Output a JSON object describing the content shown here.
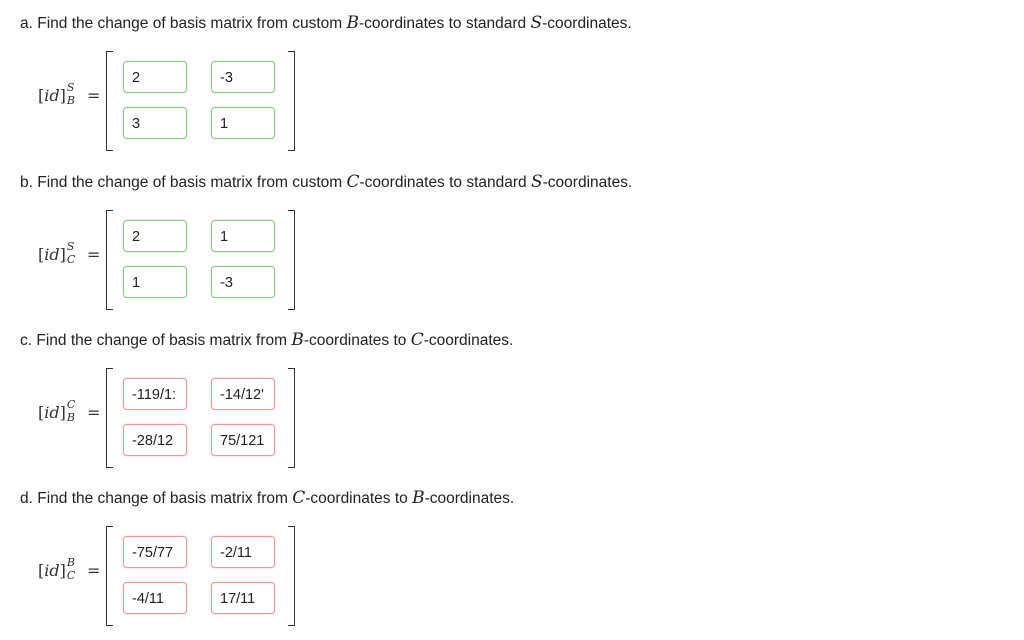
{
  "parts": [
    {
      "question": {
        "pre": "a. Find the change of basis matrix from custom ",
        "from": "B",
        "mid": "-coordinates to standard ",
        "to": "S",
        "post": "-coordinates."
      },
      "label": {
        "sup": "S",
        "sub": "B"
      },
      "cells": [
        {
          "value": "2",
          "status": "correct"
        },
        {
          "value": "-3",
          "status": "correct"
        },
        {
          "value": "3",
          "status": "correct"
        },
        {
          "value": "1",
          "status": "correct"
        }
      ]
    },
    {
      "question": {
        "pre": "b. Find the change of basis matrix from custom ",
        "from": "C",
        "mid": "-coordinates to standard ",
        "to": "S",
        "post": "-coordinates."
      },
      "label": {
        "sup": "S",
        "sub": "C"
      },
      "cells": [
        {
          "value": "2",
          "status": "correct"
        },
        {
          "value": "1",
          "status": "correct"
        },
        {
          "value": "1",
          "status": "correct"
        },
        {
          "value": "-3",
          "status": "correct"
        }
      ]
    },
    {
      "question": {
        "pre": "c. Find the change of basis matrix from ",
        "from": "B",
        "mid": "-coordinates to ",
        "to": "C",
        "post": "-coordinates."
      },
      "label": {
        "sup": "C",
        "sub": "B"
      },
      "cells": [
        {
          "value": "-119/1:",
          "status": "incorrect"
        },
        {
          "value": "-14/12'",
          "status": "incorrect"
        },
        {
          "value": "-28/12",
          "status": "incorrect"
        },
        {
          "value": "75/121",
          "status": "incorrect"
        }
      ]
    },
    {
      "question": {
        "pre": "d. Find the change of basis matrix from ",
        "from": "C",
        "mid": "-coordinates to ",
        "to": "B",
        "post": "-coordinates."
      },
      "label": {
        "sup": "B",
        "sub": "C"
      },
      "cells": [
        {
          "value": "-75/77",
          "status": "incorrect"
        },
        {
          "value": "-2/11",
          "status": "incorrect"
        },
        {
          "value": "-4/11",
          "status": "incorrect"
        },
        {
          "value": "17/11",
          "status": "incorrect"
        }
      ]
    }
  ],
  "label_text": {
    "open": "[",
    "body": "id",
    "close": "]",
    "equals": "="
  },
  "status_colors": {
    "correct": "#8fc58f",
    "incorrect": "#e89a9a"
  }
}
